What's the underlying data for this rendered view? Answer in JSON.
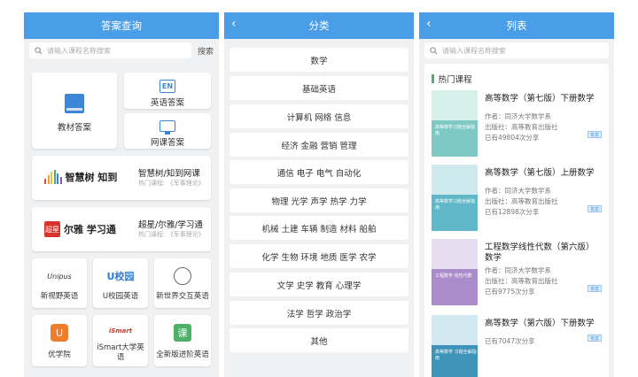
{
  "panel1": {
    "title": "答案查询",
    "search_placeholder": "请输入课程名称搜索",
    "search_button": "搜索",
    "tiles": {
      "textbook": "教材答案",
      "english": "英语答案",
      "online": "网课答案",
      "en_icon": "EN"
    },
    "zhihuishu": {
      "logo": "智慧树 知到",
      "title": "智慧树/知到网课",
      "subtitle": "热门课程: 《军事理论》"
    },
    "chaoxing": {
      "logo_mark": "超星",
      "logo": "尔雅 学习通",
      "title": "超星/尔雅/学习通",
      "subtitle": "热门课程: 《军事理论》"
    },
    "apps": [
      {
        "name": "新视野英语",
        "icon": "unipus-icon",
        "icon_text": "Unipus"
      },
      {
        "name": "U校园英语",
        "icon": "u-campus-icon",
        "icon_text": "U校园"
      },
      {
        "name": "新世界交互英语",
        "icon": "seal-icon",
        "icon_text": ""
      },
      {
        "name": "优学院",
        "icon": "youxue-icon",
        "icon_text": "U"
      },
      {
        "name": "iSmart大学英语",
        "icon": "ismart-icon",
        "icon_text": "iSmart"
      },
      {
        "name": "全新版进阶英语",
        "icon": "ke-icon",
        "icon_text": "课"
      }
    ]
  },
  "panel2": {
    "title": "分类",
    "categories": [
      "数学",
      "基础英语",
      "计算机 网络 信息",
      "经济 金融 营销 管理",
      "通信 电子 电气 自动化",
      "物理 光学 声学 热学 力学",
      "机械 土建 车辆 制造 材料 船舶",
      "化学 生物 环境 地质 医学 农学",
      "文学 史学 教育 心理学",
      "法学 哲学 政治学",
      "其他"
    ]
  },
  "panel3": {
    "title": "列表",
    "search_placeholder": "请输入课程名称搜索",
    "section_title": "热门课程",
    "tag_label": "答案",
    "items": [
      {
        "title": "高等数学（第七版）下册数学",
        "author": "作者：同济大学数学系",
        "publisher": "出版社：高等教育出版社",
        "shares": "已有49804次分享",
        "cover_title": "高等数学习题全解指南"
      },
      {
        "title": "高等数学（第七版）上册数学",
        "author": "作者：同济大学数学系",
        "publisher": "出版社：高等教育出版社",
        "shares": "已有12898次分享",
        "cover_title": "高等数学习题全解指南"
      },
      {
        "title": "工程数学线性代数（第六版）数学",
        "author": "作者：同济大学数学系",
        "publisher": "出版社：高等教育出版社",
        "shares": "已有9775次分享",
        "cover_title": "工程数学 线性代数"
      },
      {
        "title": "高等数学（第六版）下册数学",
        "author": "",
        "publisher": "",
        "shares": "已有7047次分享",
        "cover_title": "高等数学 习题全解指南"
      }
    ]
  },
  "colors": {
    "header_blue": "#4a9ee8",
    "panel_bg": "#f0f1f3",
    "accent_green": "#4fb06a"
  }
}
